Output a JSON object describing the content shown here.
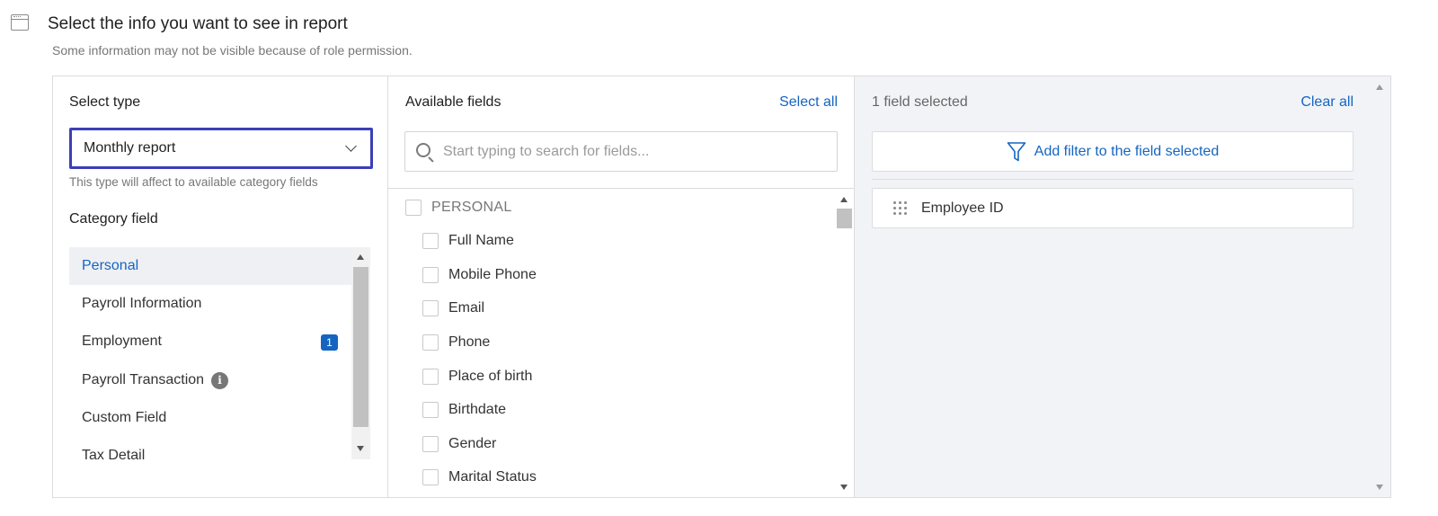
{
  "header": {
    "icon": "window-icon",
    "title": "Select the info you want to see in report",
    "subtitle": "Some information may not be visible because of role permission."
  },
  "type_panel": {
    "select_type_label": "Select type",
    "selected_type": "Monthly report",
    "hint": "This type will affect to available category fields",
    "category_label": "Category field",
    "categories": [
      {
        "label": "Personal",
        "active": true
      },
      {
        "label": "Payroll Information"
      },
      {
        "label": "Employment",
        "badge": "1"
      },
      {
        "label": "Payroll Transaction",
        "info_icon": "i"
      },
      {
        "label": "Custom Field"
      },
      {
        "label": "Tax Detail"
      }
    ]
  },
  "fields_panel": {
    "title": "Available fields",
    "select_all": "Select all",
    "search_placeholder": "Start typing to search for fields...",
    "group": "PERSONAL",
    "fields": [
      "Full Name",
      "Mobile Phone",
      "Email",
      "Phone",
      "Place of birth",
      "Birthdate",
      "Gender",
      "Marital Status"
    ]
  },
  "selected_panel": {
    "count_text": "1 field selected",
    "clear_all": "Clear all",
    "filter_button": "Add filter to the field selected",
    "selected_fields": [
      "Employee ID"
    ]
  },
  "colors": {
    "accent": "#1565c0",
    "focus_border": "#3b3fb8",
    "selected_bg": "#f2f3f7"
  }
}
